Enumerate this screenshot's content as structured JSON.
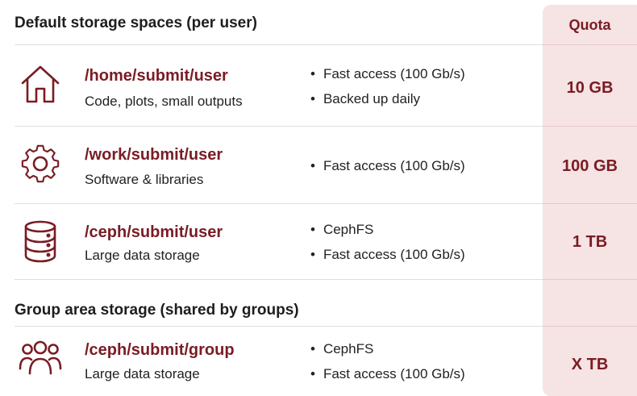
{
  "sections": {
    "default_title": "Default storage spaces (per user)",
    "quota_header": "Quota",
    "group_title": "Group area storage (shared by groups)"
  },
  "rows": [
    {
      "icon": "house-icon",
      "path": "/home/submit/user",
      "description": "Code, plots, small outputs",
      "bullets": [
        "Fast access (100 Gb/s)",
        "Backed up daily"
      ],
      "quota": "10 GB"
    },
    {
      "icon": "gear-icon",
      "path": "/work/submit/user",
      "description": "Software & libraries",
      "bullets": [
        "Fast access (100 Gb/s)"
      ],
      "quota": "100 GB"
    },
    {
      "icon": "database-icon",
      "path": "/ceph/submit/user",
      "description": "Large data storage",
      "bullets": [
        "CephFS",
        "Fast access (100 Gb/s)"
      ],
      "quota": "1 TB"
    },
    {
      "icon": "group-users-icon",
      "path": "/ceph/submit/group",
      "description": "Large data storage",
      "bullets": [
        "CephFS",
        "Fast access (100 Gb/s)"
      ],
      "quota": "X TB"
    }
  ],
  "colors": {
    "accent": "#7a1c24",
    "quota_column_bg": "#f6e3e3",
    "text": "#222222"
  }
}
